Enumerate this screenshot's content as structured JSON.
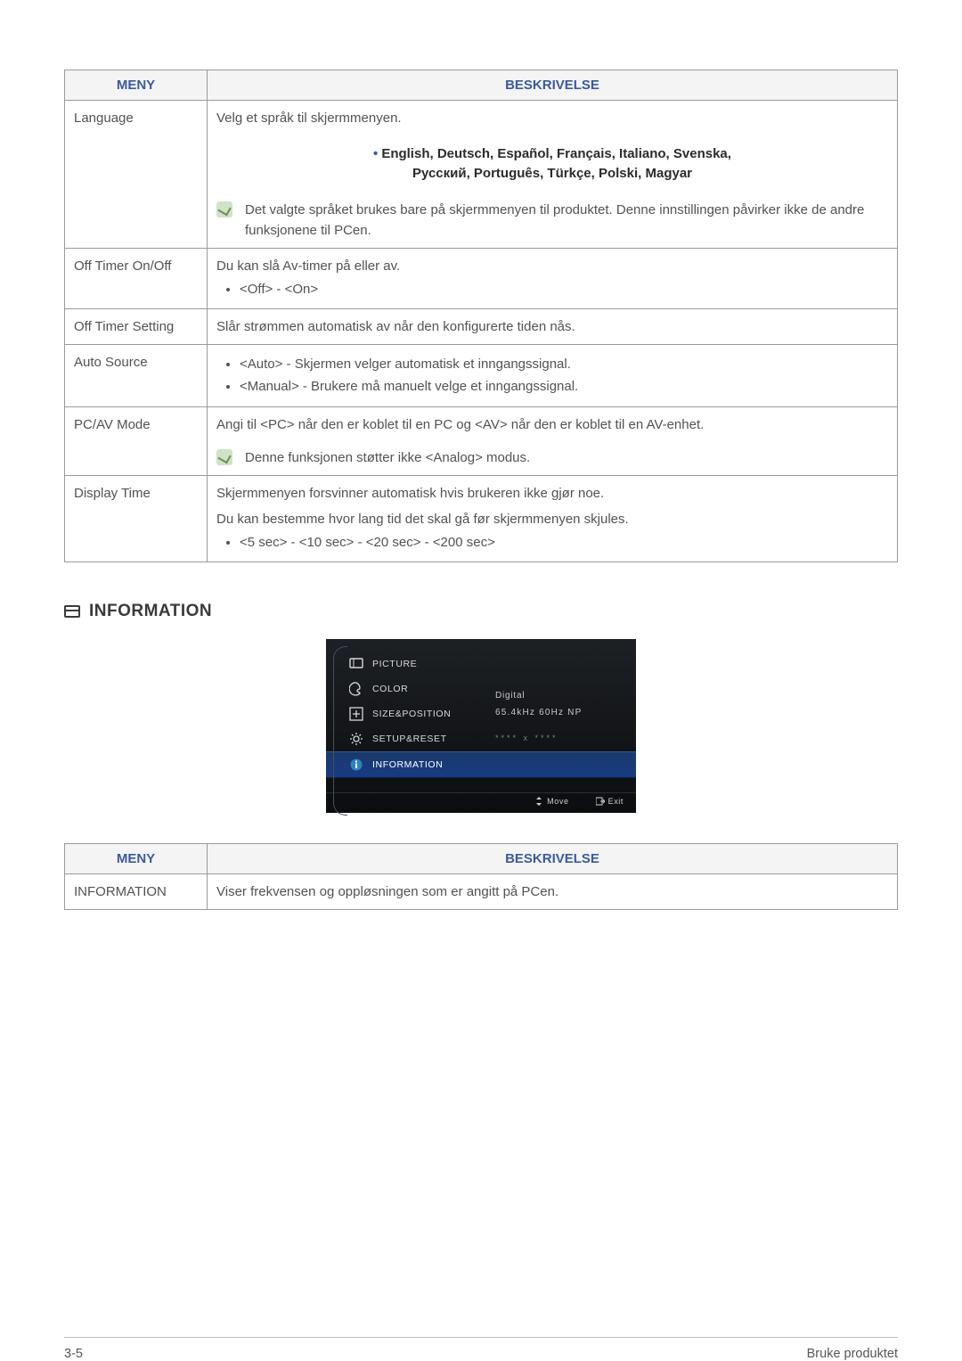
{
  "table1": {
    "header_menu": "MENY",
    "header_desc": "BESKRIVELSE",
    "rows": {
      "language": {
        "menu": "Language",
        "intro": "Velg et språk til skjermmenyen.",
        "languages_line1": "English, Deutsch, Español, Français, Italiano, Svenska,",
        "languages_line2": "Русский, Português, Türkçe, Polski, Magyar",
        "note": "Det valgte språket brukes bare på skjermmenyen til produktet. Denne innstillingen påvirker ikke de andre funksjonene til PCen."
      },
      "offtimer_onoff": {
        "menu": "Off Timer On/Off",
        "intro": "Du kan slå Av-timer på eller av.",
        "option": "<Off> - <On>"
      },
      "offtimer_setting": {
        "menu": "Off Timer Setting",
        "intro": "Slår strømmen automatisk av når den konfigurerte tiden nås."
      },
      "auto_source": {
        "menu": "Auto Source",
        "opt1": "<Auto> - Skjermen velger automatisk et inngangssignal.",
        "opt2": "<Manual> - Brukere må manuelt velge et inngangssignal."
      },
      "pcav": {
        "menu": "PC/AV Mode",
        "intro": "Angi til <PC> når den er koblet til en PC og <AV> når den er koblet til en AV-enhet.",
        "note": "Denne funksjonen støtter ikke <Analog> modus."
      },
      "display_time": {
        "menu": "Display Time",
        "l1": "Skjermmenyen forsvinner automatisk hvis brukeren ikke gjør noe.",
        "l2": "Du kan bestemme hvor lang tid det skal gå før skjermmenyen skjules.",
        "option": "<5 sec> - <10 sec> - <20 sec> - <200 sec>"
      }
    }
  },
  "section_information": "INFORMATION",
  "osd": {
    "items": [
      "PICTURE",
      "COLOR",
      "SIZE&POSITION",
      "SETUP&RESET",
      "INFORMATION"
    ],
    "right_l1": "Digital",
    "right_l2": "65.4kHz 60Hz NP",
    "right_l3": "**** x ****",
    "footer_move": "Move",
    "footer_exit": "Exit"
  },
  "table2": {
    "header_menu": "MENY",
    "header_desc": "BESKRIVELSE",
    "row": {
      "menu": "INFORMATION",
      "desc": "Viser frekvensen og oppløsningen som er angitt på PCen."
    }
  },
  "footer": {
    "left": "3-5",
    "right": "Bruke produktet"
  }
}
